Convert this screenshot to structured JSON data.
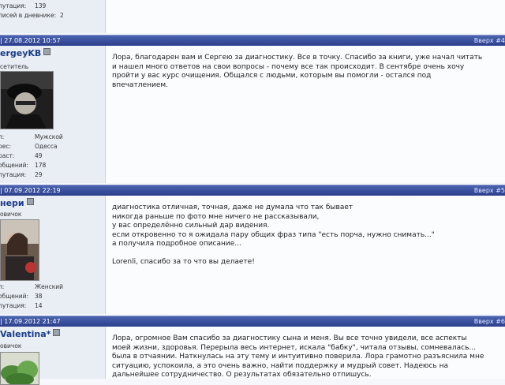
{
  "post0": {
    "stats": [
      {
        "label": "путация:",
        "value": "139"
      },
      {
        "label": "писей в дневнике:",
        "value": "2"
      }
    ]
  },
  "post1": {
    "date": "| 27.08.2012 10:57",
    "up": "Вверх #4",
    "username": "ergeyKB",
    "title": "сетитель",
    "stats": [
      {
        "label": "л:",
        "value": "Мужской"
      },
      {
        "label": "рес:",
        "value": "Одесса"
      },
      {
        "label": "раст:",
        "value": "49"
      },
      {
        "label": "общений:",
        "value": "178"
      },
      {
        "label": "путация:",
        "value": "29"
      }
    ],
    "message": "Лора, благодарен вам и Сергею за диагностику. Все в точку. Спасибо за книги, уже начал читать\nи нашел много ответов на свои вопросы - почему все так происходит. В сентябре очень хочу\nпройти у вас курс очищения. Общался с людьми, которым вы помогли - остался под\nвпечатлением."
  },
  "post2": {
    "date": "| 07.09.2012 22:19",
    "up": "Вверх #5",
    "username": "нери",
    "title": "овичок",
    "stats": [
      {
        "label": "л:",
        "value": "Женский"
      },
      {
        "label": "общений:",
        "value": "38"
      },
      {
        "label": "путация:",
        "value": "14"
      }
    ],
    "message": "диагностика отличная, точная, даже не думала что так бывает\nникогда раньше по фото мне ничего не рассказывали,\nу вас определённо сильный дар видения.\nесли откровенно то я ожидала пару общих фраз типа \"есть порча, нужно снимать...\"\nа получила подробное описание...\n\nLorenli, спасибо за то что вы делаете!"
  },
  "post3": {
    "date": "| 17.09.2012 21:47",
    "up": "Вверх #6",
    "username": "Valentina*",
    "title": "овичок",
    "message": "Лора, огромное Вам спасибо за диагностику сына и меня. Вы все точно увидели, все аспекты\nмоей жизни, здоровья. Перерыла весь интернет, искала \"бабку\", читала отзывы, сомневалась...\nбыла в отчаянии. Наткнулась на эту тему и интуитивно поверила. Лора грамотно разъяснила мне\nситуацию, успокоила, а это очень важно, найти поддержку и мудрый совет. Надеюсь на\nдальнейшее сотрудничество. О результатах обязательно отпишусь."
  }
}
